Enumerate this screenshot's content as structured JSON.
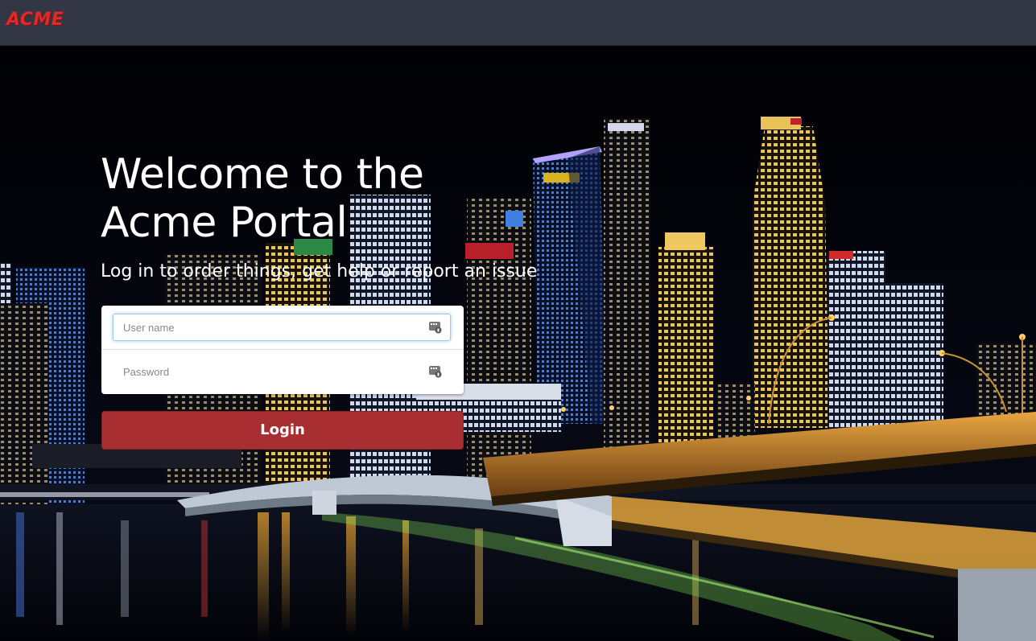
{
  "header": {
    "logo_text": "ACME"
  },
  "hero": {
    "title_line1": "Welcome to the",
    "title_line2": "Acme Portal",
    "subtitle": "Log in to order things, get help or report an issue"
  },
  "login_form": {
    "username_placeholder": "User name",
    "username_value": "",
    "password_placeholder": "Password",
    "password_value": "",
    "login_label": "Login",
    "field_icon": "password-manager-key-icon"
  },
  "colors": {
    "topbar": "#333645",
    "logo": "#e02a2a",
    "login_button": "#a92e32",
    "focus_ring": "#9ecaed"
  }
}
